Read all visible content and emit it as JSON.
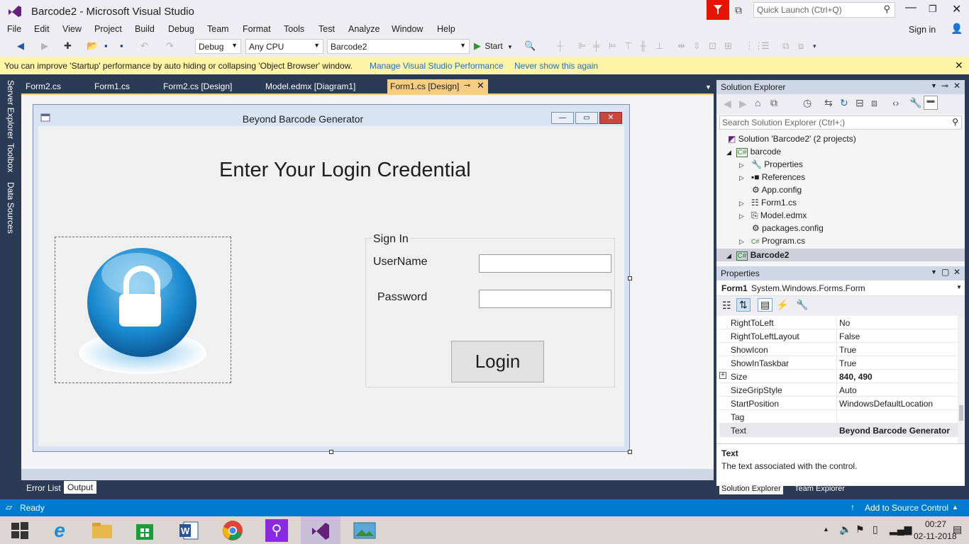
{
  "window": {
    "title": "Barcode2 - Microsoft Visual Studio",
    "quick_launch_placeholder": "Quick Launch (Ctrl+Q)",
    "sign_in": "Sign in"
  },
  "menu": [
    "File",
    "Edit",
    "View",
    "Project",
    "Build",
    "Debug",
    "Team",
    "Format",
    "Tools",
    "Test",
    "Analyze",
    "Window",
    "Help"
  ],
  "toolbar": {
    "config": "Debug",
    "platform": "Any CPU",
    "project": "Barcode2",
    "start": "Start"
  },
  "infobar": {
    "message": "You can improve 'Startup' performance by auto hiding or collapsing 'Object Browser' window.",
    "link1": "Manage Visual Studio Performance",
    "link2": "Never show this again"
  },
  "left_strip": [
    "Server Explorer",
    "Toolbox",
    "Data Sources"
  ],
  "doc_tabs": [
    "Form2.cs",
    "Form1.cs",
    "Form2.cs [Design]",
    "Model.edmx [Diagram1]",
    "Form1.cs [Design]"
  ],
  "form": {
    "title": "Beyond Barcode Generator",
    "heading": "Enter Your Login Credential",
    "group_title": "Sign In",
    "username_label": "UserName",
    "password_label": "Password",
    "username_value": "",
    "password_value": "",
    "login_button": "Login"
  },
  "output_tabs": [
    "Error List",
    "Output"
  ],
  "solution_explorer": {
    "title": "Solution Explorer",
    "search_placeholder": "Search Solution Explorer (Ctrl+;)",
    "items": [
      {
        "label": "Solution 'Barcode2' (2 projects)",
        "icon": "solution-icon"
      },
      {
        "label": "barcode",
        "icon": "csharp-project-icon"
      },
      {
        "label": "Properties",
        "icon": "wrench-icon"
      },
      {
        "label": "References",
        "icon": "references-icon"
      },
      {
        "label": "App.config",
        "icon": "config-file-icon"
      },
      {
        "label": "Form1.cs",
        "icon": "form-icon"
      },
      {
        "label": "Model.edmx",
        "icon": "edmx-icon"
      },
      {
        "label": "packages.config",
        "icon": "config-file-icon"
      },
      {
        "label": "Program.cs",
        "icon": "csharp-file-icon"
      },
      {
        "label": "Barcode2",
        "icon": "csharp-project-icon"
      }
    ]
  },
  "properties": {
    "title": "Properties",
    "object": "Form1",
    "object_type": "System.Windows.Forms.Form",
    "rows": [
      {
        "name": "RightToLeft",
        "value": "No"
      },
      {
        "name": "RightToLeftLayout",
        "value": "False"
      },
      {
        "name": "ShowIcon",
        "value": "True"
      },
      {
        "name": "ShowInTaskbar",
        "value": "True"
      },
      {
        "name": "Size",
        "value": "840, 490"
      },
      {
        "name": "SizeGripStyle",
        "value": "Auto"
      },
      {
        "name": "StartPosition",
        "value": "WindowsDefaultLocation"
      },
      {
        "name": "Tag",
        "value": ""
      },
      {
        "name": "Text",
        "value": "Beyond Barcode Generator"
      }
    ],
    "desc_title": "Text",
    "desc_body": "The text associated with the control."
  },
  "bottom_tabs": [
    "Solution Explorer",
    "Team Explorer"
  ],
  "status": {
    "ready": "Ready",
    "source_control": "Add to Source Control"
  },
  "taskbar": {
    "time": "00:27",
    "date": "02-11-2018"
  },
  "colors": {
    "vs_blue": "#007acc",
    "vs_dark": "#2b3a55",
    "vs_purple": "#68217a",
    "infobar": "#fdf4a6"
  }
}
